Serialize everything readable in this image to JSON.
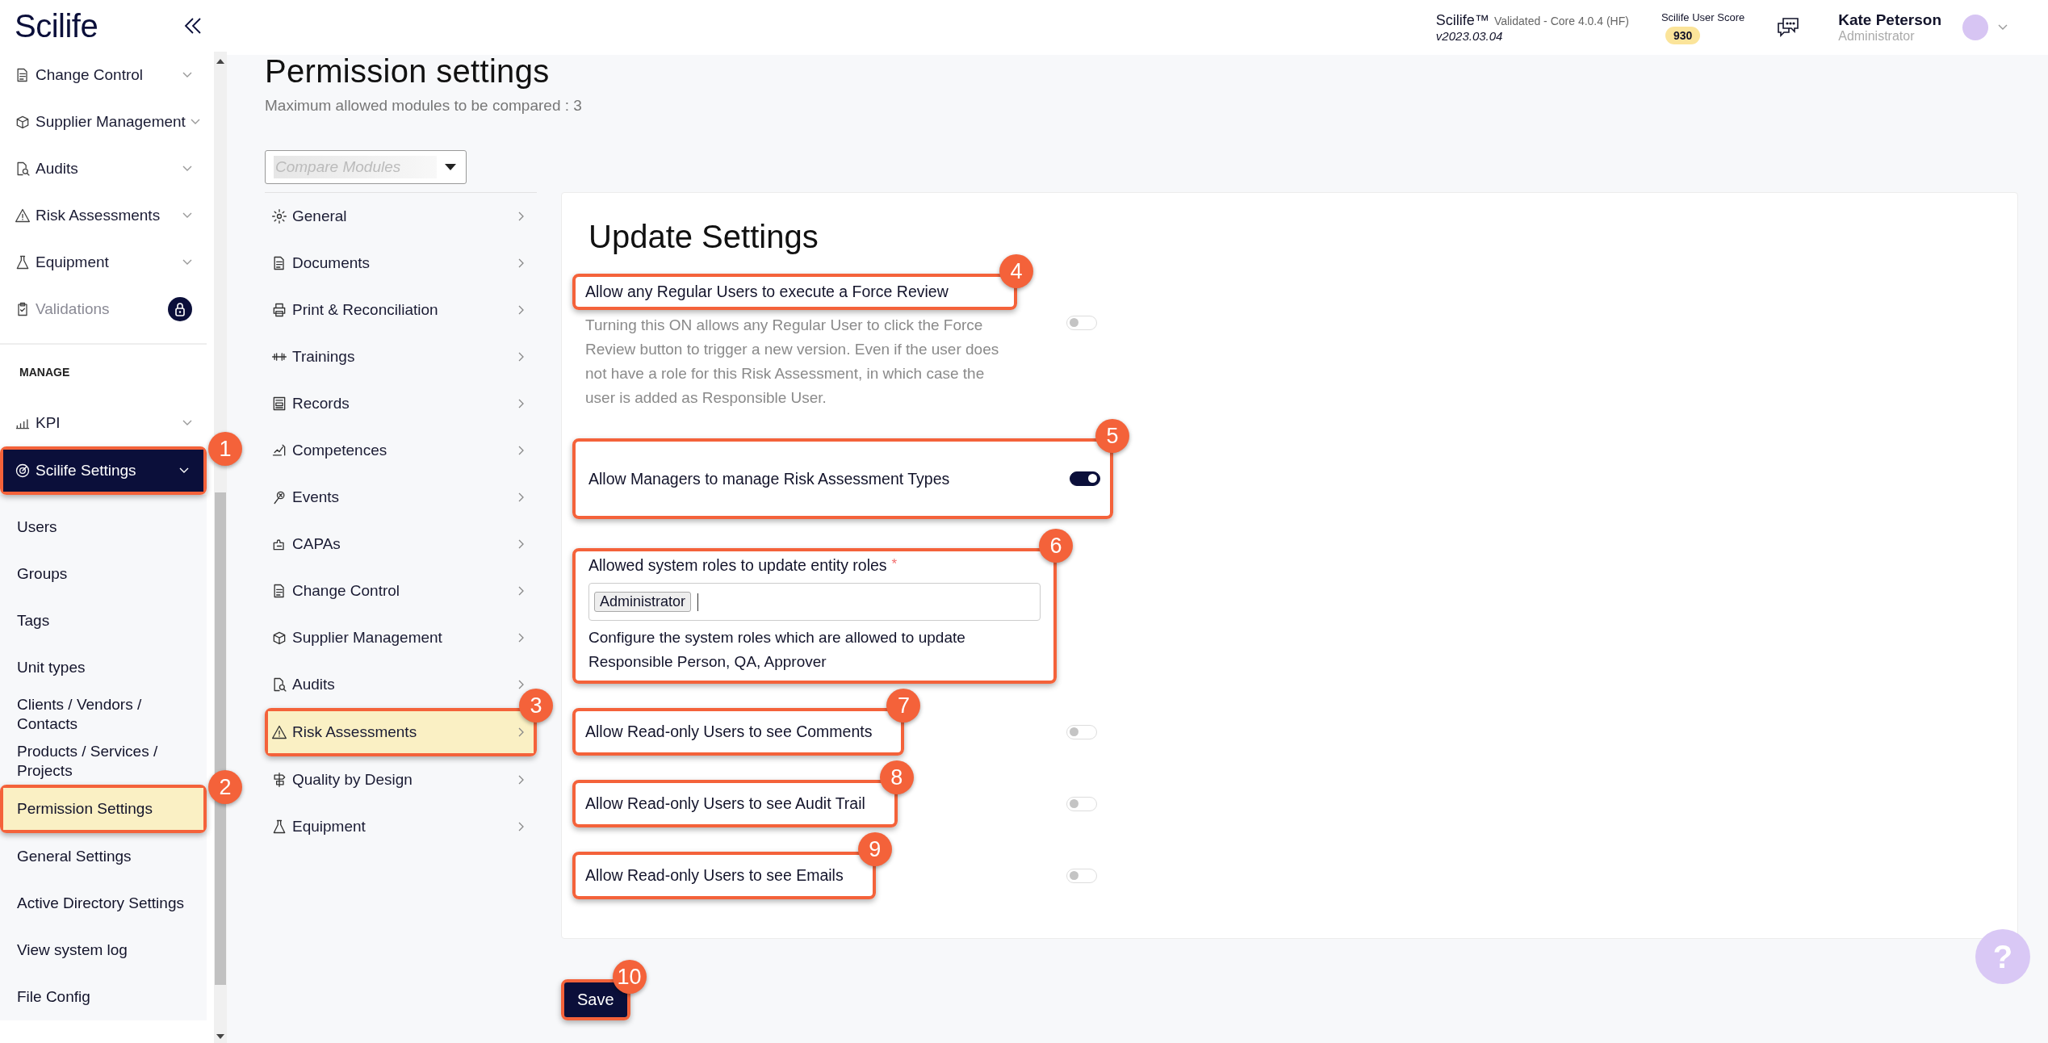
{
  "sidebar": {
    "logo": "Scilife",
    "modules": [
      {
        "label": "Change Control",
        "locked": false
      },
      {
        "label": "Supplier Management",
        "locked": false
      },
      {
        "label": "Audits",
        "locked": false
      },
      {
        "label": "Risk Assessments",
        "locked": false
      },
      {
        "label": "Equipment",
        "locked": false
      },
      {
        "label": "Validations",
        "locked": true
      }
    ],
    "section_title": "MANAGE",
    "manage": [
      {
        "label": "KPI",
        "expanded": false
      },
      {
        "label": "Scilife Settings",
        "expanded": true,
        "callout": "1",
        "children": [
          {
            "label": "Users",
            "selected": false
          },
          {
            "label": "Groups",
            "selected": false
          },
          {
            "label": "Tags",
            "selected": false
          },
          {
            "label": "Unit types",
            "selected": false
          },
          {
            "label": "Clients / Vendors / Contacts",
            "selected": false
          },
          {
            "label": "Products / Services / Projects",
            "selected": false
          },
          {
            "label": "Permission Settings",
            "selected": true,
            "callout": "2"
          },
          {
            "label": "General Settings",
            "selected": false
          },
          {
            "label": "Active Directory Settings",
            "selected": false
          },
          {
            "label": "View system log",
            "selected": false
          },
          {
            "label": "File Config",
            "selected": false
          }
        ]
      }
    ]
  },
  "header": {
    "product": "Scilife™",
    "edition": "Validated - Core 4.0.4 (HF)",
    "version": "v2023.03.04",
    "score_label": "Scilife User Score",
    "score": "930",
    "user_name": "Kate Peterson",
    "user_role": "Administrator"
  },
  "page": {
    "title": "Permission settings",
    "subtitle": "Maximum allowed modules to be compared : 3",
    "compare": {
      "placeholder": "Compare Modules"
    },
    "modules": [
      {
        "label": "General",
        "selected": false
      },
      {
        "label": "Documents",
        "selected": false
      },
      {
        "label": "Print & Reconciliation",
        "selected": false
      },
      {
        "label": "Trainings",
        "selected": false
      },
      {
        "label": "Records",
        "selected": false
      },
      {
        "label": "Competences",
        "selected": false
      },
      {
        "label": "Events",
        "selected": false
      },
      {
        "label": "CAPAs",
        "selected": false
      },
      {
        "label": "Change Control",
        "selected": false
      },
      {
        "label": "Supplier Management",
        "selected": false
      },
      {
        "label": "Audits",
        "selected": false
      },
      {
        "label": "Risk Assessments",
        "selected": true,
        "callout": "3"
      },
      {
        "label": "Quality by Design",
        "selected": false
      },
      {
        "label": "Equipment",
        "selected": false
      }
    ]
  },
  "settings": {
    "title": "Update Settings",
    "rows": [
      {
        "kind": "toggle",
        "label": "Allow any Regular Users to execute a Force Review",
        "description": "Turning this ON allows any Regular User to click the Force Review button to trigger a new version. Even if the user does not have a role for this Risk Assessment, in which case the user is added as Responsible User.",
        "on": false,
        "row_highlight": false,
        "callout": "4"
      },
      {
        "kind": "toggle",
        "label": "Allow Managers to manage Risk Assessment Types",
        "on": true,
        "row_highlight": true,
        "callout": "5"
      },
      {
        "kind": "roles",
        "label": "Allowed system roles to update entity roles",
        "required_mark": "*",
        "tags": [
          "Administrator"
        ],
        "help": "Configure the system roles which are allowed to update Responsible Person, QA, Approver",
        "callout": "6"
      },
      {
        "kind": "toggle",
        "label": "Allow Read-only Users to see Comments",
        "on": false,
        "row_highlight": false,
        "callout": "7"
      },
      {
        "kind": "toggle",
        "label": "Allow Read-only Users to see Audit Trail",
        "on": false,
        "row_highlight": false,
        "callout": "8"
      },
      {
        "kind": "toggle",
        "label": "Allow Read-only Users to see Emails",
        "on": false,
        "row_highlight": false,
        "callout": "9"
      }
    ]
  },
  "save": {
    "label": "Save",
    "callout": "10"
  },
  "help": {
    "label": "?"
  }
}
